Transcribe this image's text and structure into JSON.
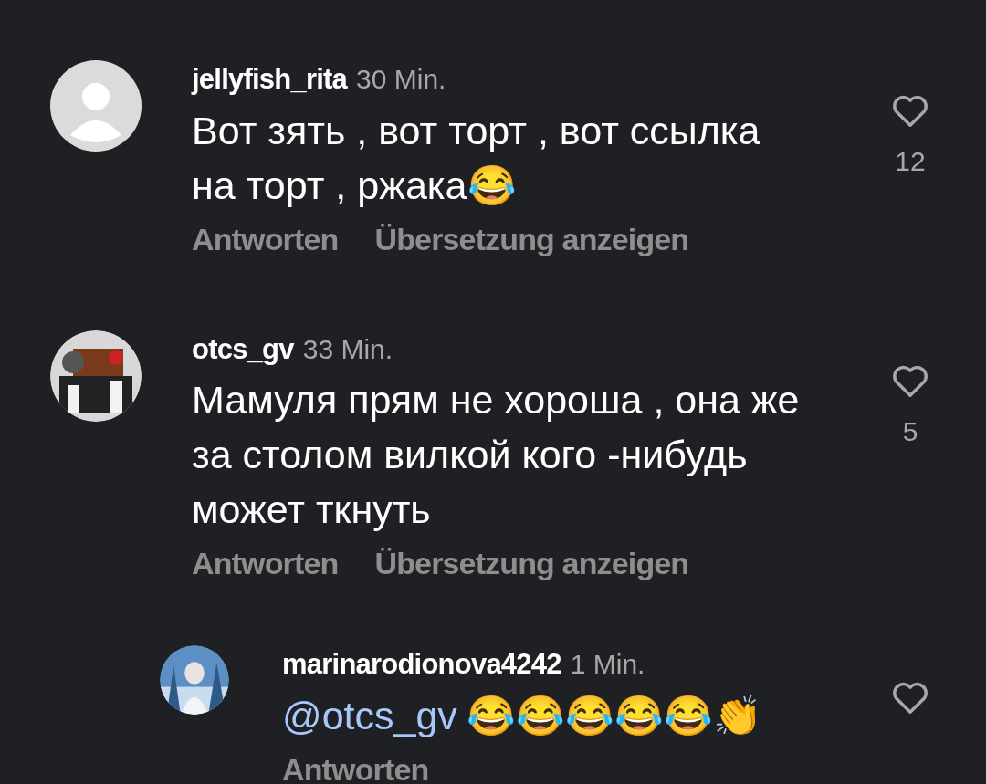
{
  "comments": [
    {
      "kind": "comment",
      "avatar": {
        "kind": "silhouette"
      },
      "username": "jellyfish_rita",
      "time": "30 Min.",
      "text": "Вот зять , вот торт , вот ссылка на торт , ржака😂",
      "likes": "12",
      "actions": [
        "Antworten",
        "Übersetzung anzeigen"
      ]
    },
    {
      "kind": "comment",
      "avatar": {
        "kind": "picture"
      },
      "username": "otcs_gv",
      "time": "33 Min.",
      "text": "Мамуля прям не хороша , она же за столом вилкой кого -нибудь может ткнуть",
      "likes": "5",
      "actions": [
        "Antworten",
        "Übersetzung anzeigen"
      ]
    },
    {
      "kind": "reply",
      "avatar": {
        "kind": "picture"
      },
      "username": "marinarodionova4242",
      "time": "1 Min.",
      "mention": "@otcs_gv",
      "text": "😂😂😂😂😂👏",
      "actions": [
        "Antworten"
      ]
    }
  ]
}
